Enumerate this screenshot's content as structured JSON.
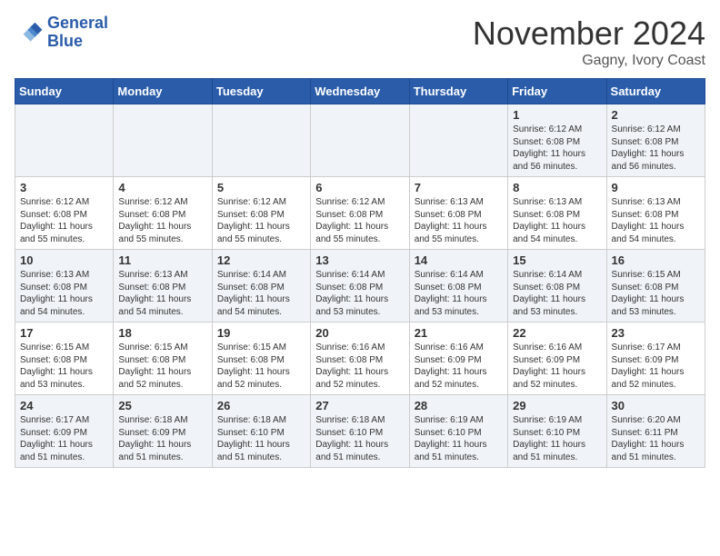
{
  "header": {
    "logo_line1": "General",
    "logo_line2": "Blue",
    "month": "November 2024",
    "location": "Gagny, Ivory Coast"
  },
  "weekdays": [
    "Sunday",
    "Monday",
    "Tuesday",
    "Wednesday",
    "Thursday",
    "Friday",
    "Saturday"
  ],
  "weeks": [
    [
      {
        "day": "",
        "info": ""
      },
      {
        "day": "",
        "info": ""
      },
      {
        "day": "",
        "info": ""
      },
      {
        "day": "",
        "info": ""
      },
      {
        "day": "",
        "info": ""
      },
      {
        "day": "1",
        "info": "Sunrise: 6:12 AM\nSunset: 6:08 PM\nDaylight: 11 hours and 56 minutes."
      },
      {
        "day": "2",
        "info": "Sunrise: 6:12 AM\nSunset: 6:08 PM\nDaylight: 11 hours and 56 minutes."
      }
    ],
    [
      {
        "day": "3",
        "info": "Sunrise: 6:12 AM\nSunset: 6:08 PM\nDaylight: 11 hours and 55 minutes."
      },
      {
        "day": "4",
        "info": "Sunrise: 6:12 AM\nSunset: 6:08 PM\nDaylight: 11 hours and 55 minutes."
      },
      {
        "day": "5",
        "info": "Sunrise: 6:12 AM\nSunset: 6:08 PM\nDaylight: 11 hours and 55 minutes."
      },
      {
        "day": "6",
        "info": "Sunrise: 6:12 AM\nSunset: 6:08 PM\nDaylight: 11 hours and 55 minutes."
      },
      {
        "day": "7",
        "info": "Sunrise: 6:13 AM\nSunset: 6:08 PM\nDaylight: 11 hours and 55 minutes."
      },
      {
        "day": "8",
        "info": "Sunrise: 6:13 AM\nSunset: 6:08 PM\nDaylight: 11 hours and 54 minutes."
      },
      {
        "day": "9",
        "info": "Sunrise: 6:13 AM\nSunset: 6:08 PM\nDaylight: 11 hours and 54 minutes."
      }
    ],
    [
      {
        "day": "10",
        "info": "Sunrise: 6:13 AM\nSunset: 6:08 PM\nDaylight: 11 hours and 54 minutes."
      },
      {
        "day": "11",
        "info": "Sunrise: 6:13 AM\nSunset: 6:08 PM\nDaylight: 11 hours and 54 minutes."
      },
      {
        "day": "12",
        "info": "Sunrise: 6:14 AM\nSunset: 6:08 PM\nDaylight: 11 hours and 54 minutes."
      },
      {
        "day": "13",
        "info": "Sunrise: 6:14 AM\nSunset: 6:08 PM\nDaylight: 11 hours and 53 minutes."
      },
      {
        "day": "14",
        "info": "Sunrise: 6:14 AM\nSunset: 6:08 PM\nDaylight: 11 hours and 53 minutes."
      },
      {
        "day": "15",
        "info": "Sunrise: 6:14 AM\nSunset: 6:08 PM\nDaylight: 11 hours and 53 minutes."
      },
      {
        "day": "16",
        "info": "Sunrise: 6:15 AM\nSunset: 6:08 PM\nDaylight: 11 hours and 53 minutes."
      }
    ],
    [
      {
        "day": "17",
        "info": "Sunrise: 6:15 AM\nSunset: 6:08 PM\nDaylight: 11 hours and 53 minutes."
      },
      {
        "day": "18",
        "info": "Sunrise: 6:15 AM\nSunset: 6:08 PM\nDaylight: 11 hours and 52 minutes."
      },
      {
        "day": "19",
        "info": "Sunrise: 6:15 AM\nSunset: 6:08 PM\nDaylight: 11 hours and 52 minutes."
      },
      {
        "day": "20",
        "info": "Sunrise: 6:16 AM\nSunset: 6:08 PM\nDaylight: 11 hours and 52 minutes."
      },
      {
        "day": "21",
        "info": "Sunrise: 6:16 AM\nSunset: 6:09 PM\nDaylight: 11 hours and 52 minutes."
      },
      {
        "day": "22",
        "info": "Sunrise: 6:16 AM\nSunset: 6:09 PM\nDaylight: 11 hours and 52 minutes."
      },
      {
        "day": "23",
        "info": "Sunrise: 6:17 AM\nSunset: 6:09 PM\nDaylight: 11 hours and 52 minutes."
      }
    ],
    [
      {
        "day": "24",
        "info": "Sunrise: 6:17 AM\nSunset: 6:09 PM\nDaylight: 11 hours and 51 minutes."
      },
      {
        "day": "25",
        "info": "Sunrise: 6:18 AM\nSunset: 6:09 PM\nDaylight: 11 hours and 51 minutes."
      },
      {
        "day": "26",
        "info": "Sunrise: 6:18 AM\nSunset: 6:10 PM\nDaylight: 11 hours and 51 minutes."
      },
      {
        "day": "27",
        "info": "Sunrise: 6:18 AM\nSunset: 6:10 PM\nDaylight: 11 hours and 51 minutes."
      },
      {
        "day": "28",
        "info": "Sunrise: 6:19 AM\nSunset: 6:10 PM\nDaylight: 11 hours and 51 minutes."
      },
      {
        "day": "29",
        "info": "Sunrise: 6:19 AM\nSunset: 6:10 PM\nDaylight: 11 hours and 51 minutes."
      },
      {
        "day": "30",
        "info": "Sunrise: 6:20 AM\nSunset: 6:11 PM\nDaylight: 11 hours and 51 minutes."
      }
    ]
  ]
}
